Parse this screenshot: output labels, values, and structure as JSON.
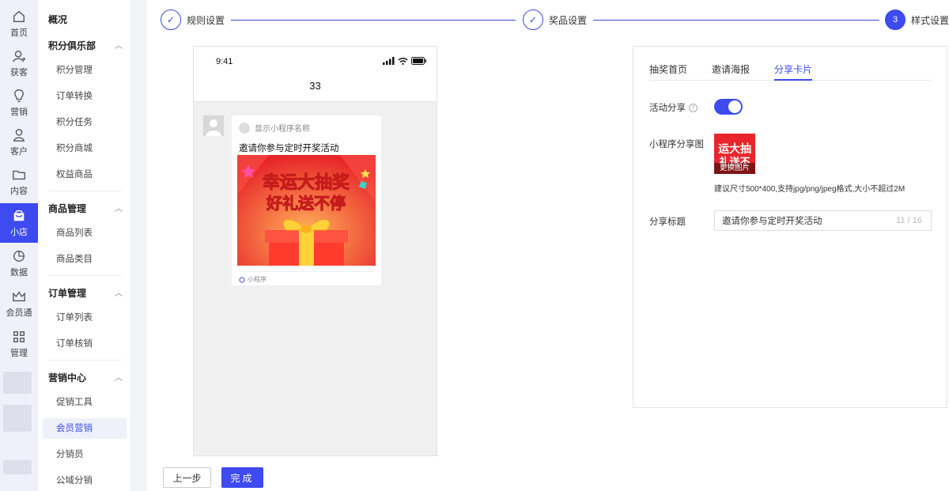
{
  "rail": {
    "items": [
      {
        "label": "首页",
        "icon": "home-icon"
      },
      {
        "label": "获客",
        "icon": "user-plus-icon"
      },
      {
        "label": "营销",
        "icon": "lightbulb-icon"
      },
      {
        "label": "客户",
        "icon": "user-icon"
      },
      {
        "label": "内容",
        "icon": "folder-icon"
      },
      {
        "label": "小店",
        "icon": "shop-icon",
        "active": true
      },
      {
        "label": "数据",
        "icon": "pie-chart-icon"
      },
      {
        "label": "会员通",
        "icon": "crown-icon"
      },
      {
        "label": "管理",
        "icon": "grid-icon"
      }
    ]
  },
  "subnav": {
    "overview": "概况",
    "groups": [
      {
        "title": "积分俱乐部",
        "items": [
          "积分管理",
          "订单转换",
          "积分任务",
          "积分商城",
          "权益商品"
        ]
      },
      {
        "title": "商品管理",
        "items": [
          "商品列表",
          "商品类目"
        ]
      },
      {
        "title": "订单管理",
        "items": [
          "订单列表",
          "订单核销"
        ]
      },
      {
        "title": "营销中心",
        "items": [
          "促销工具",
          "会员营销",
          "分销员",
          "公域分销"
        ]
      }
    ],
    "active_item": "会员营销"
  },
  "steps": [
    {
      "label": "规则设置",
      "state": "done"
    },
    {
      "label": "奖品设置",
      "state": "done"
    },
    {
      "label": "样式设置",
      "state": "current",
      "number": "3"
    }
  ],
  "phone": {
    "time": "9:41",
    "title": "33",
    "card": {
      "app_name": "显示小程序名称",
      "title": "邀请你参与定时开奖活动",
      "banner_line1": "幸运大抽奖",
      "banner_line2": "好礼送不停",
      "footer": "小程序"
    }
  },
  "panel": {
    "tabs": [
      "抽奖首页",
      "邀请海报",
      "分享卡片"
    ],
    "active_tab": "分享卡片",
    "share_toggle_label": "活动分享",
    "share_toggle_on": true,
    "share_image_label": "小程序分享图",
    "thumb_text_line1": "运大抽",
    "thumb_text_line2": "礼送不",
    "change_image": "更换图片",
    "hint": "建议尺寸500*400,支持jpg/png/jpeg格式,大小不超过2M",
    "share_title_label": "分享标题",
    "share_title_value": "邀请你参与定时开奖活动",
    "share_title_count": "11 / 16"
  },
  "buttons": {
    "prev": "上一步",
    "done": "完成"
  },
  "colors": {
    "accent": "#3d4bf0",
    "banner_red": "#f0412a",
    "gift_yellow": "#ffd23a"
  }
}
